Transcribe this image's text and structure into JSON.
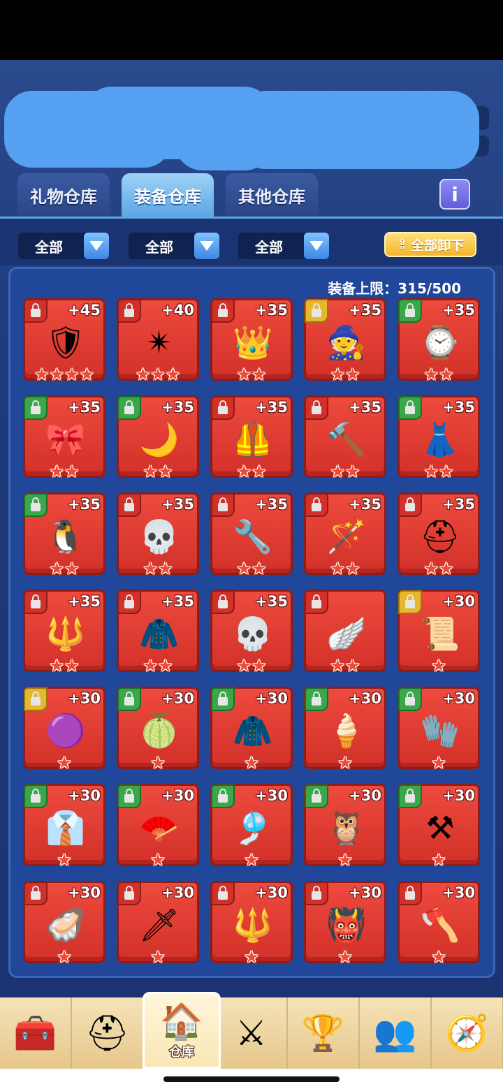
{
  "tabs": [
    "礼物仓库",
    "装备仓库",
    "其他仓库"
  ],
  "active_tab": 1,
  "info_label": "i",
  "filters": [
    "全部",
    "全部",
    "全部"
  ],
  "unequip_all": "全部卸下",
  "limit_text": "装备上限：315/500",
  "items": [
    {
      "level": "+45",
      "lock": "red",
      "icon": "🛡",
      "stars": 4
    },
    {
      "level": "+40",
      "lock": "red",
      "icon": "✴",
      "stars": 3
    },
    {
      "level": "+35",
      "lock": "red",
      "icon": "👑",
      "stars": 2
    },
    {
      "level": "+35",
      "lock": "yellow",
      "icon": "🧙",
      "stars": 2
    },
    {
      "level": "+35",
      "lock": "green",
      "icon": "⌚",
      "stars": 2
    },
    {
      "level": "+35",
      "lock": "green",
      "icon": "🎀",
      "stars": 2
    },
    {
      "level": "+35",
      "lock": "green",
      "icon": "🌙",
      "stars": 2
    },
    {
      "level": "+35",
      "lock": "red",
      "icon": "🦺",
      "stars": 2
    },
    {
      "level": "+35",
      "lock": "red",
      "icon": "🔨",
      "stars": 2
    },
    {
      "level": "+35",
      "lock": "green",
      "icon": "👗",
      "stars": 2
    },
    {
      "level": "+35",
      "lock": "green",
      "icon": "🐧",
      "stars": 2
    },
    {
      "level": "+35",
      "lock": "red",
      "icon": "💀",
      "stars": 2
    },
    {
      "level": "+35",
      "lock": "red",
      "icon": "🔧",
      "stars": 2
    },
    {
      "level": "+35",
      "lock": "red",
      "icon": "🪄",
      "stars": 2
    },
    {
      "level": "+35",
      "lock": "red",
      "icon": "⛑",
      "stars": 2
    },
    {
      "level": "+35",
      "lock": "red",
      "icon": "🔱",
      "stars": 2
    },
    {
      "level": "+35",
      "lock": "red",
      "icon": "🧥",
      "stars": 2
    },
    {
      "level": "+35",
      "lock": "red",
      "icon": "💀",
      "stars": 2
    },
    {
      "level": "",
      "lock": "red",
      "icon": "🪽",
      "stars": 2
    },
    {
      "level": "+30",
      "lock": "yellow",
      "icon": "📜",
      "stars": 1
    },
    {
      "level": "+30",
      "lock": "yellow",
      "icon": "🟣",
      "stars": 1
    },
    {
      "level": "+30",
      "lock": "green",
      "icon": "🍈",
      "stars": 1
    },
    {
      "level": "+30",
      "lock": "green",
      "icon": "🧥",
      "stars": 1
    },
    {
      "level": "+30",
      "lock": "green",
      "icon": "🍦",
      "stars": 1
    },
    {
      "level": "+30",
      "lock": "green",
      "icon": "🧤",
      "stars": 1
    },
    {
      "level": "+30",
      "lock": "green",
      "icon": "👔",
      "stars": 1
    },
    {
      "level": "+30",
      "lock": "green",
      "icon": "🪭",
      "stars": 1
    },
    {
      "level": "+30",
      "lock": "green",
      "icon": "🎐",
      "stars": 1
    },
    {
      "level": "+30",
      "lock": "green",
      "icon": "🦉",
      "stars": 1
    },
    {
      "level": "+30",
      "lock": "green",
      "icon": "⚒",
      "stars": 1
    },
    {
      "level": "+30",
      "lock": "red",
      "icon": "🦪",
      "stars": 1
    },
    {
      "level": "+30",
      "lock": "red",
      "icon": "🗡",
      "stars": 1
    },
    {
      "level": "+30",
      "lock": "red",
      "icon": "🔱",
      "stars": 1
    },
    {
      "level": "+30",
      "lock": "red",
      "icon": "👹",
      "stars": 1
    },
    {
      "level": "+30",
      "lock": "red",
      "icon": "🪓",
      "stars": 1
    }
  ],
  "nav": [
    {
      "icon": "🧰",
      "label": ""
    },
    {
      "icon": "⛑",
      "label": ""
    },
    {
      "icon": "🏠",
      "label": "仓库"
    },
    {
      "icon": "⚔",
      "label": ""
    },
    {
      "icon": "🏆",
      "label": ""
    },
    {
      "icon": "👥",
      "label": ""
    },
    {
      "icon": "🧭",
      "label": ""
    }
  ],
  "active_nav": 2,
  "colors": {
    "panel": "#21479a",
    "cell": "#ee4a3e",
    "accent": "#5aa6e6"
  }
}
